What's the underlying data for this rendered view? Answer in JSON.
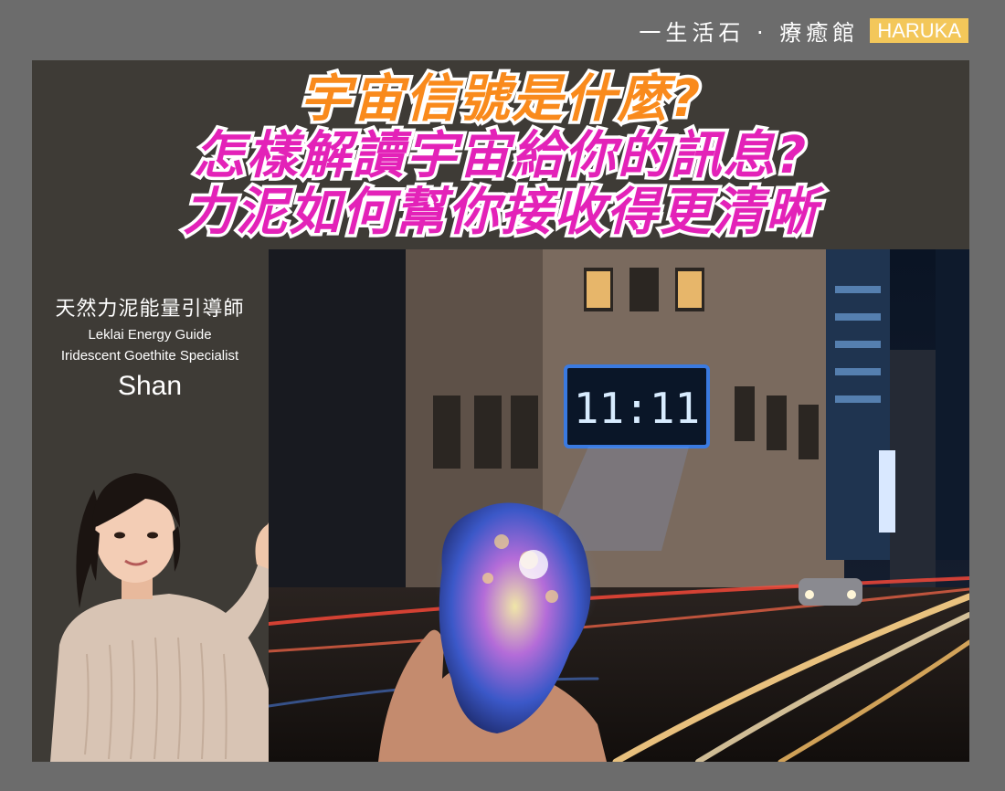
{
  "brand": {
    "name": "一生活石 · 療癒館",
    "badge": "HARUKA"
  },
  "headline": {
    "line1": "宇宙信號是什麼?",
    "line2": "怎樣解讀宇宙給你的訊息?",
    "line3": "力泥如何幫你接收得更清晰"
  },
  "guide": {
    "title_zh": "天然力泥能量引導師",
    "title_en": "Leklai Energy Guide",
    "subtitle_en": "Iridescent Goethite Specialist",
    "name": "Shan"
  },
  "photo": {
    "clock": "11:11"
  },
  "colors": {
    "page_bg": "#6c6c6c",
    "panel_bg": "#3e3b36",
    "headline_orange": "#f98a1c",
    "headline_magenta": "#e322b8",
    "badge_yellow": "#f3c75a"
  }
}
